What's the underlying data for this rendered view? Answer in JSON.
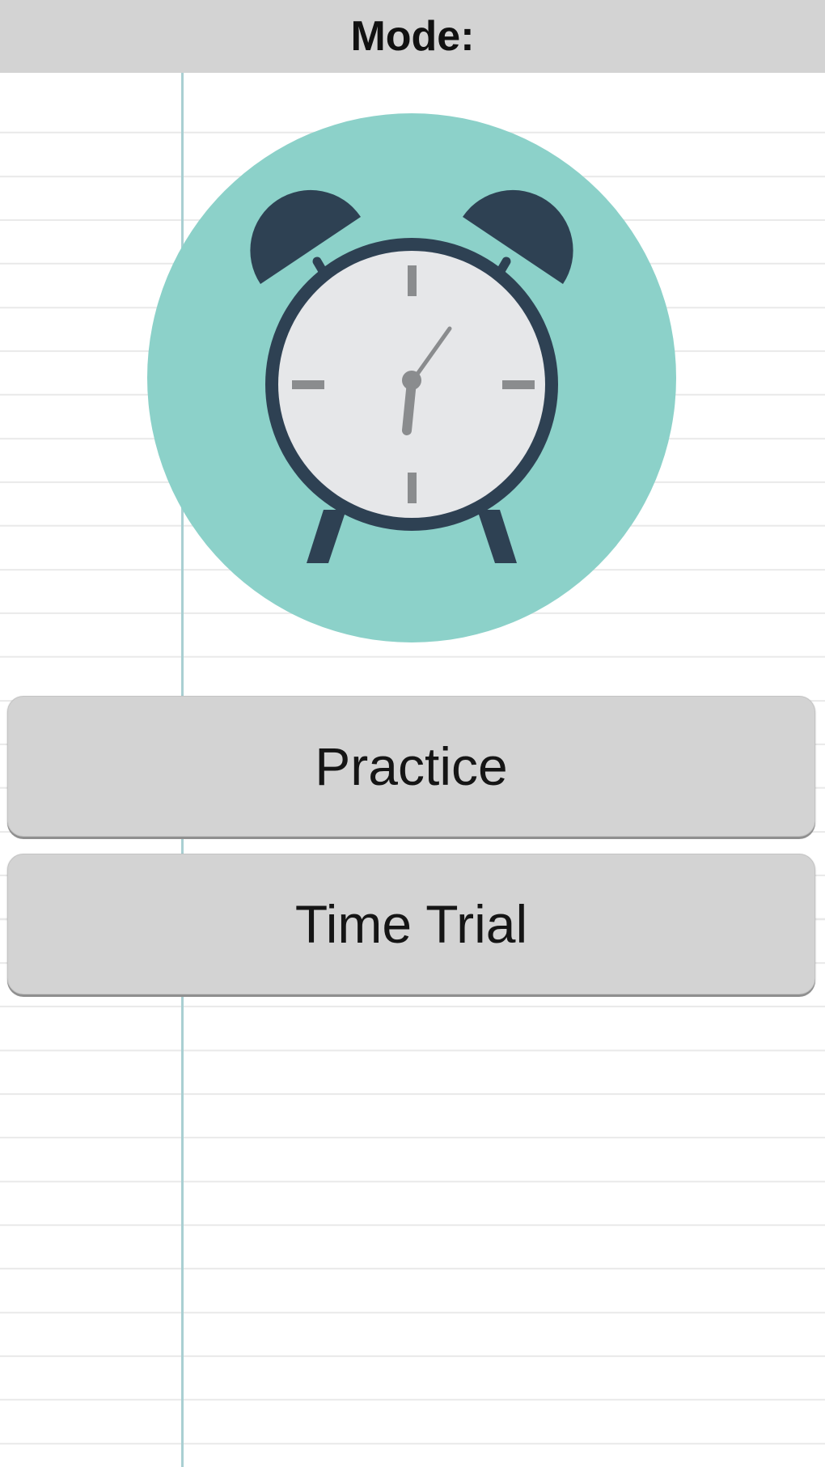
{
  "header": {
    "title": "Mode:"
  },
  "illustration": {
    "icon": "alarm-clock-icon",
    "colors": {
      "circle": "#8cd1c9",
      "dark": "#2e4153",
      "face": "#e6e7e9",
      "marks": "#8a8c8e"
    }
  },
  "modes": [
    {
      "label": "Practice"
    },
    {
      "label": "Time Trial"
    }
  ],
  "colors": {
    "header_bg": "#d3d3d3",
    "button_bg": "#d3d3d3",
    "margin_line": "#a9cfd2",
    "rule_lines": "#e9e9e9"
  }
}
